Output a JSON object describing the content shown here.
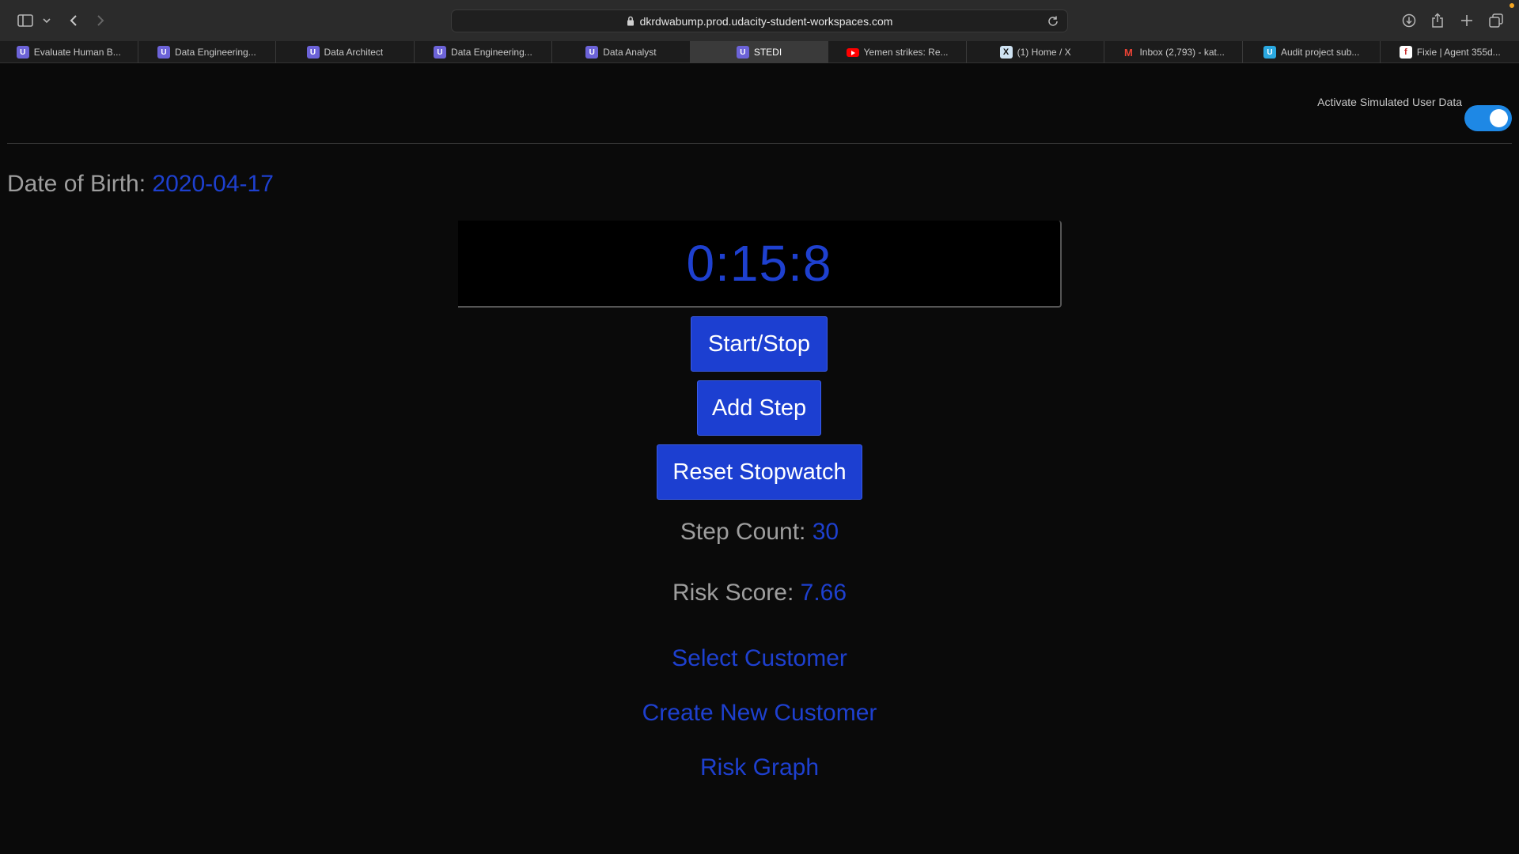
{
  "browser": {
    "url": "dkrdwabump.prod.udacity-student-workspaces.com",
    "tabs": [
      {
        "label": "Evaluate Human B...",
        "icon": "udacity-icon"
      },
      {
        "label": "Data Engineering...",
        "icon": "udacity-icon"
      },
      {
        "label": "Data Architect",
        "icon": "udacity-icon"
      },
      {
        "label": "Data Engineering...",
        "icon": "udacity-icon"
      },
      {
        "label": "Data Analyst",
        "icon": "udacity-icon"
      },
      {
        "label": "STEDI",
        "icon": "udacity-icon",
        "active": true
      },
      {
        "label": "Yemen strikes: Re...",
        "icon": "youtube-icon"
      },
      {
        "label": "(1) Home / X",
        "icon": "x-icon"
      },
      {
        "label": "Inbox (2,793) - kat...",
        "icon": "gmail-icon"
      },
      {
        "label": "Audit project sub...",
        "icon": "udacity-icon"
      },
      {
        "label": "Fixie | Agent 355d...",
        "icon": "fixie-icon"
      }
    ]
  },
  "page": {
    "toggle_label": "Activate Simulated User Data",
    "toggle_on": true,
    "dob_label": "Date of Birth:",
    "dob_value": "2020-04-17",
    "timer": "0:15:8",
    "buttons": {
      "start_stop": "Start/Stop",
      "add_step": "Add Step",
      "reset": "Reset Stopwatch"
    },
    "step_count_label": "Step Count:",
    "step_count_value": "30",
    "risk_score_label": "Risk Score:",
    "risk_score_value": "7.66",
    "links": {
      "select_customer": "Select Customer",
      "create_customer": "Create New Customer",
      "risk_graph": "Risk Graph"
    }
  },
  "colors": {
    "accent_blue": "#1e40cf",
    "toggle_blue": "#1e88e5",
    "button_blue": "#1c3fd1"
  }
}
